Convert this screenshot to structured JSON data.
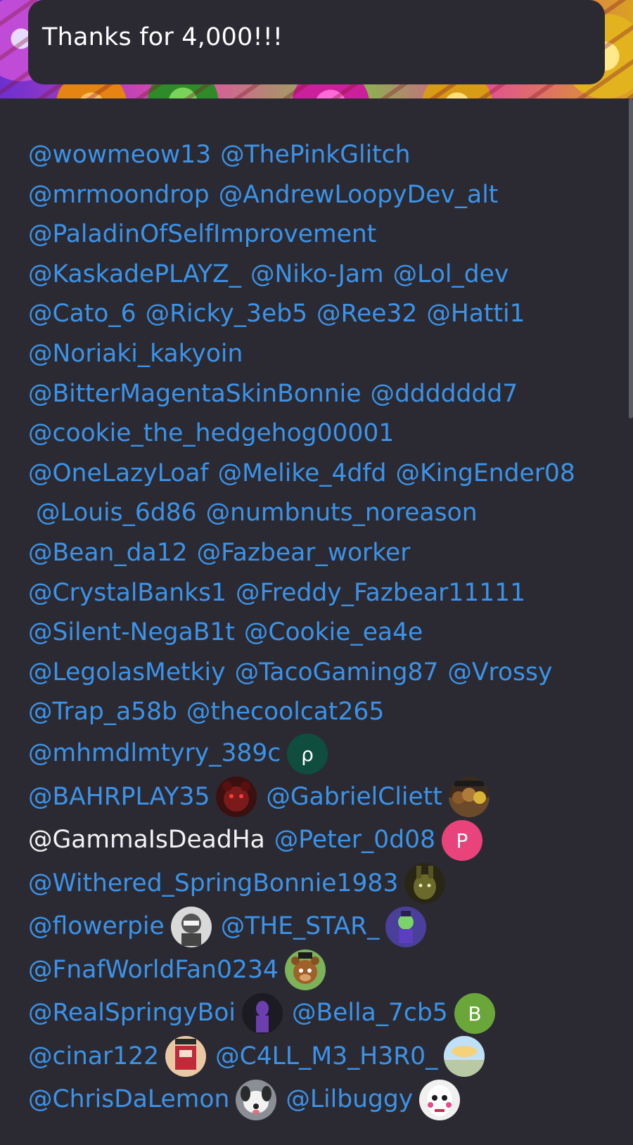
{
  "post": {
    "title": "Thanks for 4,000!!!"
  },
  "lines": [
    [
      {
        "text": "@wowmeow13"
      },
      {
        "text": "@ThePinkGlitch"
      }
    ],
    [
      {
        "text": "@mrmoondrop"
      },
      {
        "text": "@AndrewLoopyDev_alt"
      }
    ],
    [
      {
        "text": "@PaladinOfSelfImprovement"
      }
    ],
    [
      {
        "text": "@KaskadePLAYZ_"
      },
      {
        "text": "@Niko-Jam"
      },
      {
        "text": "@Lol_dev"
      }
    ],
    [
      {
        "text": "@Cato_6"
      },
      {
        "text": "@Ricky_3eb5"
      },
      {
        "text": "@Ree32"
      },
      {
        "text": "@Hatti1"
      }
    ],
    [
      {
        "text": "@Noriaki_kakyoin"
      }
    ],
    [
      {
        "text": "@BitterMagentaSkinBonnie"
      },
      {
        "text": "@ddddddd7"
      }
    ],
    [
      {
        "text": "@cookie_the_hedgehog00001"
      }
    ],
    [
      {
        "text": "@OneLazyLoaf"
      },
      {
        "text": "@Melike_4dfd"
      },
      {
        "text": "@KingEnder08"
      }
    ],
    [
      {
        "text": " @Louis_6d86"
      },
      {
        "text": "@numbnuts_noreason"
      }
    ],
    [
      {
        "text": "@Bean_da12"
      },
      {
        "text": "@Fazbear_worker"
      }
    ],
    [
      {
        "text": "@CrystalBanks1"
      },
      {
        "text": "@Freddy_Fazbear11111"
      }
    ],
    [
      {
        "text": "@Silent-NegaB1t"
      },
      {
        "text": "@Cookie_ea4e"
      }
    ],
    [
      {
        "text": "@LegolasMetkiy"
      },
      {
        "text": "@TacoGaming87"
      },
      {
        "text": "@Vrossy"
      }
    ],
    [
      {
        "text": "@Trap_a58b"
      },
      {
        "text": "@thecoolcat265"
      }
    ],
    [
      {
        "text": "@mhmdlmtyry_389c",
        "avatar": {
          "icon": "letter",
          "letter": "ρ",
          "color": "#0f4d3f"
        }
      }
    ],
    [
      {
        "text": "@BAHRPLAY35",
        "avatar": {
          "icon": "freddy-dark-icon",
          "color": "#3a1010"
        }
      },
      {
        "text": "@GabrielCliett",
        "avatar": {
          "icon": "fnaf-group-icon",
          "color": "#3b2b1f"
        }
      }
    ],
    [
      {
        "text": "@GammaIsDeadHa",
        "plain": true
      },
      {
        "text": "@Peter_0d08",
        "avatar": {
          "icon": "letter",
          "letter": "P",
          "color": "#e8437a"
        }
      }
    ],
    [
      {
        "text": "@Withered_SpringBonnie1983",
        "avatar": {
          "icon": "springtrap-icon",
          "color": "#2a2616"
        }
      }
    ],
    [
      {
        "text": "@flowerpie",
        "avatar": {
          "icon": "ninja-icon",
          "color": "#d9d9d9"
        }
      },
      {
        "text": "@THE_STAR_",
        "avatar": {
          "icon": "purple-character-icon",
          "color": "#4a3f9a"
        }
      }
    ],
    [
      {
        "text": "@FnafWorldFan0234",
        "avatar": {
          "icon": "freddy-icon",
          "color": "#7cb35a"
        }
      }
    ],
    [
      {
        "text": "@RealSpringyBoi",
        "avatar": {
          "icon": "purple-guy-icon",
          "color": "#1c1a22"
        }
      },
      {
        "text": "@Bella_7cb5",
        "avatar": {
          "icon": "letter",
          "letter": "B",
          "color": "#6aa63a"
        }
      }
    ],
    [
      {
        "text": "@cinar122",
        "avatar": {
          "icon": "pixel-character-icon",
          "color": "#e9c9a4"
        }
      },
      {
        "text": "@C4LL_M3_H3R0_",
        "avatar": {
          "icon": "landscape-icon",
          "color": "#c9dff2"
        }
      }
    ],
    [
      {
        "text": "@ChrisDaLemon",
        "avatar": {
          "icon": "dog-icon",
          "color": "#8a8f96"
        }
      },
      {
        "text": "@Lilbuggy",
        "avatar": {
          "icon": "clown-mask-icon",
          "color": "#f0f0f0"
        }
      }
    ]
  ]
}
